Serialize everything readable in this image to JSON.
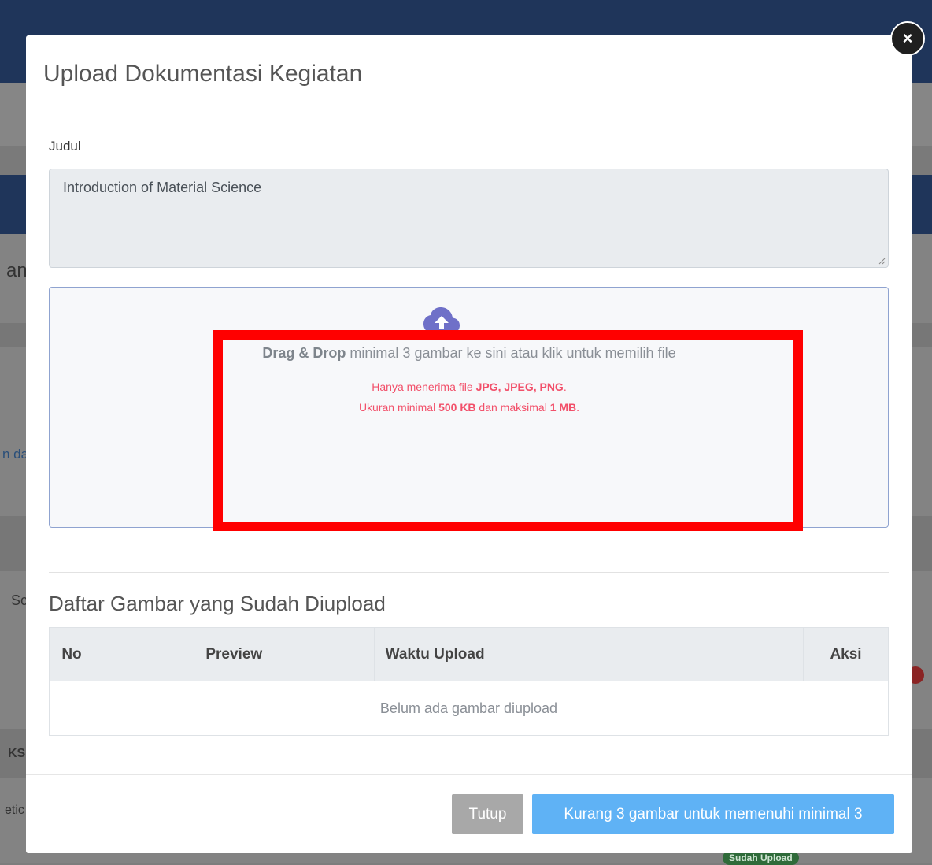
{
  "background": {
    "side_texts": [
      "an",
      "n da",
      "Sc",
      "KS",
      "etic"
    ],
    "badge": "Sudah Upload"
  },
  "modal": {
    "title": "Upload Dokumentasi Kegiatan",
    "close_symbol": "×"
  },
  "form": {
    "judul_label": "Judul",
    "judul_value": "Introduction of Material Science"
  },
  "dropzone": {
    "icon": "cloud-upload-icon",
    "main_bold": "Drag & Drop",
    "main_rest": " minimal 3 gambar ke sini atau klik untuk memilih file",
    "accept_prefix": "Hanya menerima file ",
    "accept_types": "JPG, JPEG, PNG",
    "accept_suffix": ".",
    "size_prefix": "Ukuran minimal ",
    "size_min": "500 KB",
    "size_mid": " dan maksimal ",
    "size_max": "1 MB",
    "size_suffix": "."
  },
  "uploaded": {
    "heading": "Daftar Gambar yang Sudah Diupload",
    "columns": [
      "No",
      "Preview",
      "Waktu Upload",
      "Aksi"
    ],
    "empty_message": "Belum ada gambar diupload"
  },
  "footer": {
    "close_label": "Tutup",
    "submit_label": "Kurang 3 gambar untuk memenuhi minimal 3"
  },
  "colors": {
    "accent": "#5fb2f5",
    "note": "#f2506a",
    "highlight": "#ff0000"
  }
}
